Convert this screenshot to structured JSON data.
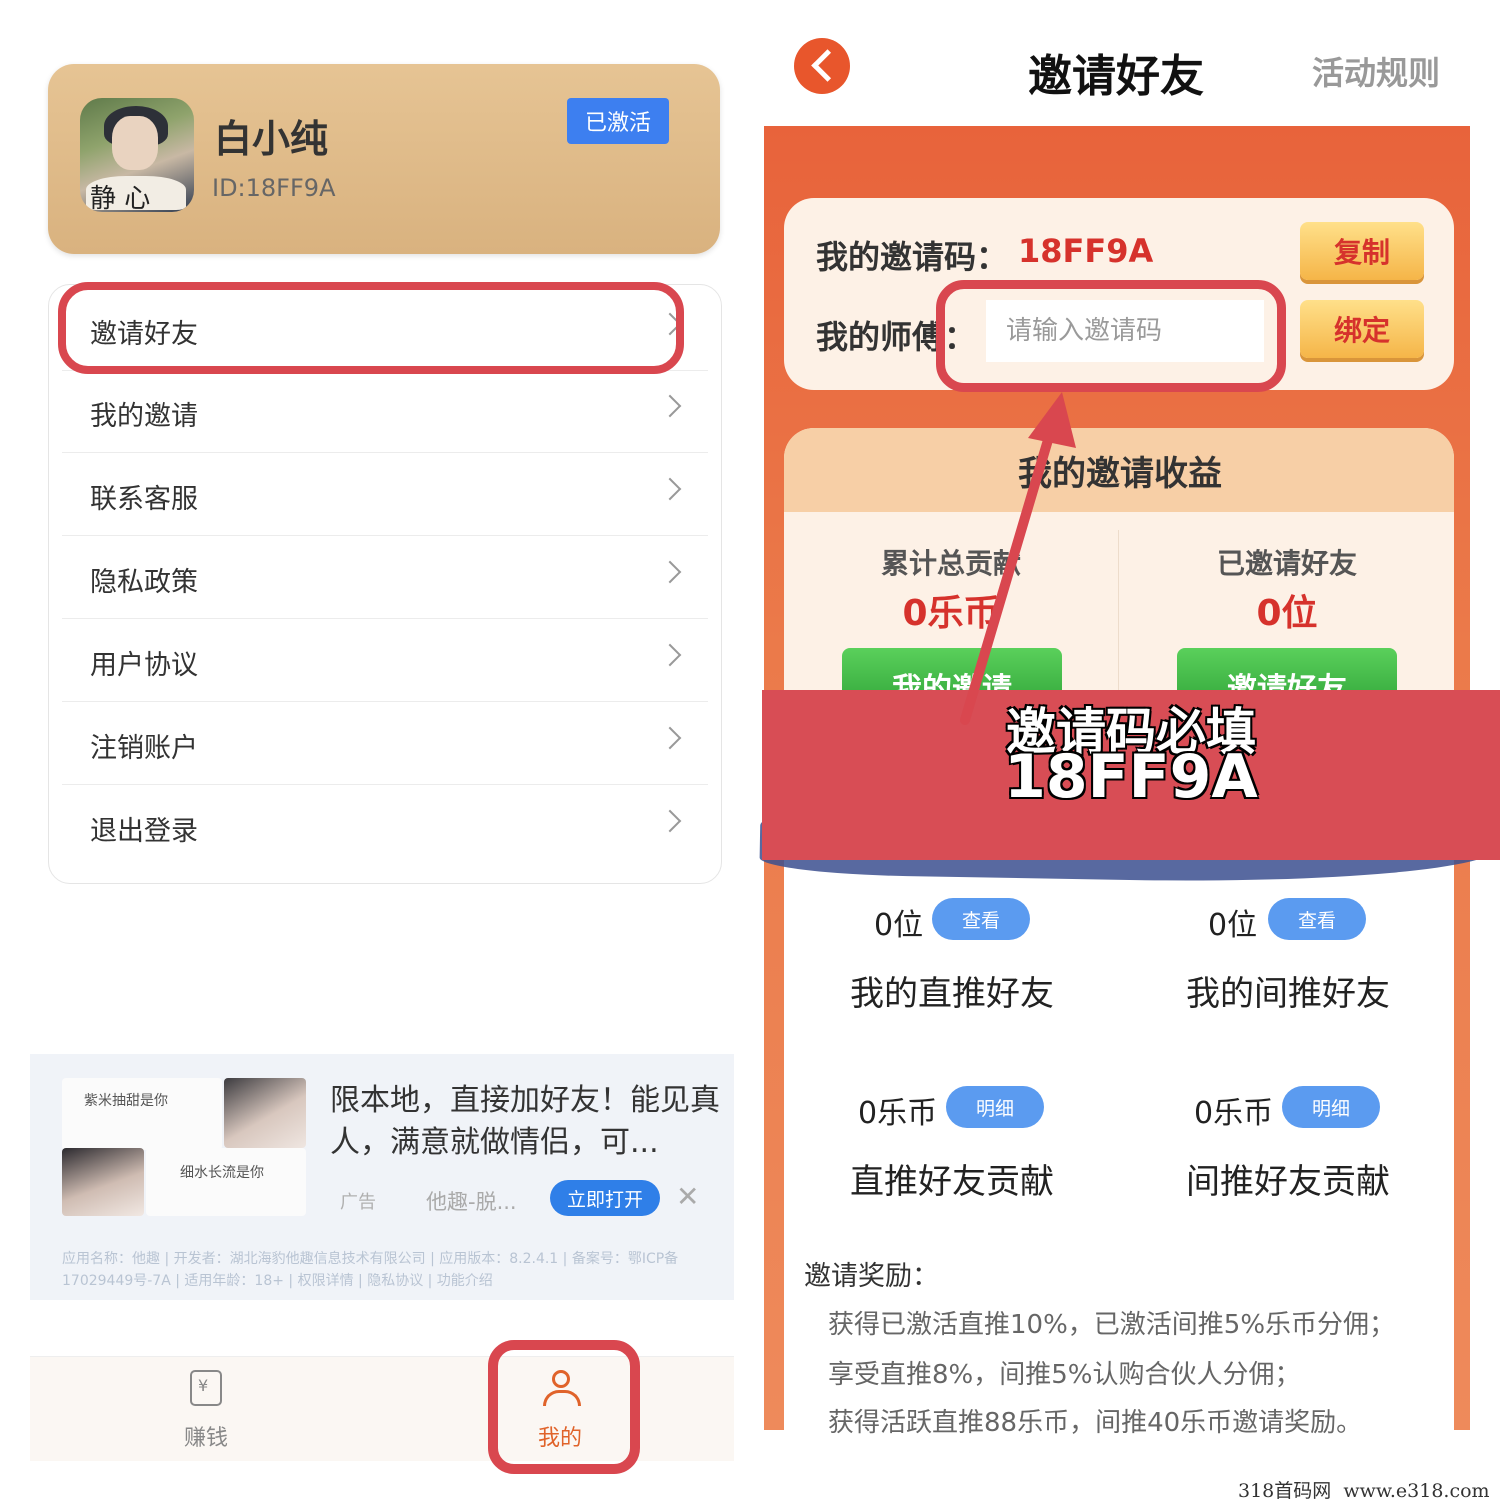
{
  "profile": {
    "avatar_text": "静 心",
    "username": "白小纯",
    "user_id": "ID:18FF9A",
    "status_badge": "已激活"
  },
  "menu": {
    "items": [
      {
        "label": "邀请好友"
      },
      {
        "label": "我的邀请"
      },
      {
        "label": "联系客服"
      },
      {
        "label": "隐私政策"
      },
      {
        "label": "用户协议"
      },
      {
        "label": "注销账户"
      },
      {
        "label": "退出登录"
      }
    ]
  },
  "ad": {
    "image1_text": "紫米抽甜是你",
    "image4_text": "细水长流是你",
    "headline": "限本地，直接加好友！能见真人，满意就做情侣，可...",
    "tag": "广告",
    "source": "他趣-脱...",
    "open_button": "立即打开",
    "close_icon": "close-icon",
    "info": "应用名称：他趣 | 开发者：湖北海豹他趣信息技术有限公司 | 应用版本：8.2.4.1 | 备案号：鄂ICP备17029449号-7A | 适用年龄：18+ | 权限详情 | 隐私协议 | 功能介绍"
  },
  "tabs": [
    {
      "label": "赚钱",
      "icon": "wallet-icon"
    },
    {
      "label": "我的",
      "icon": "user-icon",
      "active": true
    }
  ],
  "invite_page": {
    "title": "邀请好友",
    "rules_link": "活动规则",
    "my_code_label": "我的邀请码：",
    "my_code_value": "18FF9A",
    "copy_button": "复制",
    "master_label": "我的师傅：",
    "input_placeholder": "请输入邀请码",
    "bind_button": "绑定",
    "earnings_title": "我的邀请收益",
    "total_contribution_label": "累计总贡献",
    "total_contribution_value": "0乐币",
    "invited_friends_label": "已邀请好友",
    "invited_friends_value": "0位",
    "my_invites_button": "我的邀请",
    "invite_friends_button": "邀请好友",
    "direct_count": "0位",
    "indirect_count": "0位",
    "view_button": "查看",
    "direct_friends_label": "我的直推好友",
    "indirect_friends_label": "我的间推好友",
    "direct_coins": "0乐币",
    "indirect_coins": "0乐币",
    "detail_button": "明细",
    "direct_contribution_label": "直推好友贡献",
    "indirect_contribution_label": "间推好友贡献",
    "reward_title": "邀请奖励：",
    "reward_lines": [
      "获得已激活直推10%，已激活间推5%乐币分佣；",
      "享受直推8%，间推5%认购合伙人分佣；",
      "获得活跃直推88乐币，间推40乐币邀请奖励。"
    ]
  },
  "overlay": {
    "line1": "邀请码必填",
    "line2": "18FF9A"
  },
  "watermark": "318首码网  www.e318.com",
  "colors": {
    "accent_orange": "#e8633b",
    "highlight_red": "#d9474f",
    "code_red": "#d6322c",
    "badge_blue": "#3d7ff0",
    "profile_gold": "#d9b27f"
  }
}
